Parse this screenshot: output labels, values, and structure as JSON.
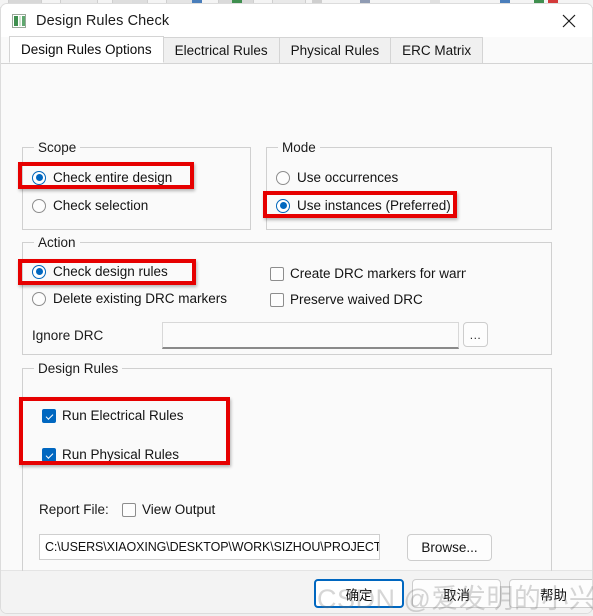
{
  "window": {
    "title": "Design Rules Check",
    "icon": "app-window-icon",
    "close_icon": "close-icon"
  },
  "tabs": [
    {
      "label": "Design Rules Options",
      "active": true
    },
    {
      "label": "Electrical Rules",
      "active": false
    },
    {
      "label": "Physical Rules",
      "active": false
    },
    {
      "label": "ERC Matrix",
      "active": false
    }
  ],
  "scope": {
    "legend": "Scope",
    "options": [
      {
        "label": "Check entire design",
        "checked": true
      },
      {
        "label": "Check selection",
        "checked": false
      }
    ]
  },
  "mode": {
    "legend": "Mode",
    "options": [
      {
        "label": "Use occurrences",
        "checked": false
      },
      {
        "label": "Use instances (Preferred)",
        "checked": true
      }
    ]
  },
  "action": {
    "legend": "Action",
    "radios": [
      {
        "label": "Check design rules",
        "checked": true
      },
      {
        "label": "Delete existing DRC markers",
        "checked": false
      }
    ],
    "checkboxes": [
      {
        "label": "Create DRC markers for warnings",
        "checked": false
      },
      {
        "label": "Preserve waived DRC",
        "checked": false
      }
    ],
    "ignore_drc_label": "Ignore DRC",
    "ignore_drc_value": "",
    "ignore_drc_placeholder": "",
    "ignore_drc_browse_label": "..."
  },
  "design_rules": {
    "legend": "Design Rules",
    "checkboxes": [
      {
        "label": "Run Electrical Rules",
        "checked": true
      },
      {
        "label": "Run Physical Rules",
        "checked": true
      }
    ]
  },
  "report": {
    "label": "Report File:",
    "view_output_label": "View Output",
    "view_output_checked": false,
    "path_value": "C:\\USERS\\XIAOXING\\DESKTOP\\WORK\\SIZHOU\\PROJECT",
    "browse_label": "Browse..."
  },
  "footer": {
    "buttons": [
      {
        "label": "确定",
        "default": true
      },
      {
        "label": "取消",
        "default": false
      },
      {
        "label": "帮助",
        "default": false
      }
    ]
  },
  "watermark": {
    "text": "CSDN @爱发明的小兴"
  },
  "annotations": {
    "color": "#e60000",
    "boxes": [
      {
        "name": "annotation-check-entire-design"
      },
      {
        "name": "annotation-use-instances"
      },
      {
        "name": "annotation-check-design-rules"
      },
      {
        "name": "annotation-design-rules-checkboxes"
      }
    ]
  }
}
